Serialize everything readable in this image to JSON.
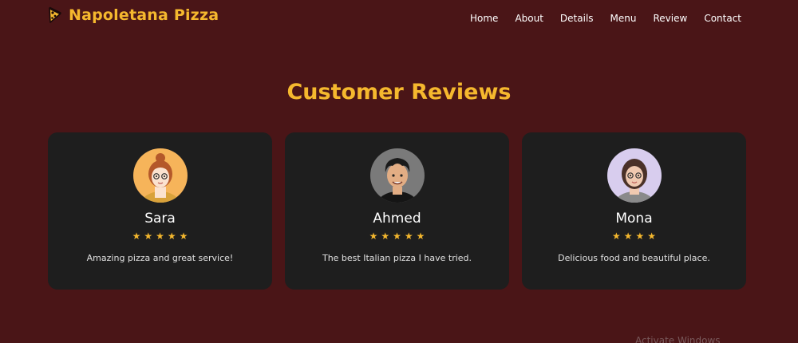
{
  "brand": {
    "name": "Napoletana Pizza",
    "icon": "pizza-slice-icon",
    "color": "#f5b82e"
  },
  "nav": [
    {
      "label": "Home"
    },
    {
      "label": "About"
    },
    {
      "label": "Details"
    },
    {
      "label": "Menu"
    },
    {
      "label": "Review"
    },
    {
      "label": "Contact"
    }
  ],
  "reviews_section": {
    "title": "Customer Reviews",
    "reviews": [
      {
        "name": "Sara",
        "rating": 5,
        "stars": "★★★★★",
        "text": "Amazing pizza and great service!",
        "avatar": "sara-avatar"
      },
      {
        "name": "Ahmed",
        "rating": 5,
        "stars": "★★★★★",
        "text": "The best Italian pizza I have tried.",
        "avatar": "ahmed-avatar"
      },
      {
        "name": "Mona",
        "rating": 4,
        "stars": "★★★★",
        "text": "Delicious food and beautiful place.",
        "avatar": "mona-avatar"
      }
    ]
  },
  "watermark": "Activate Windows",
  "colors": {
    "background": "#4a1517",
    "card": "#1e1e1e",
    "accent": "#f5b82e"
  }
}
